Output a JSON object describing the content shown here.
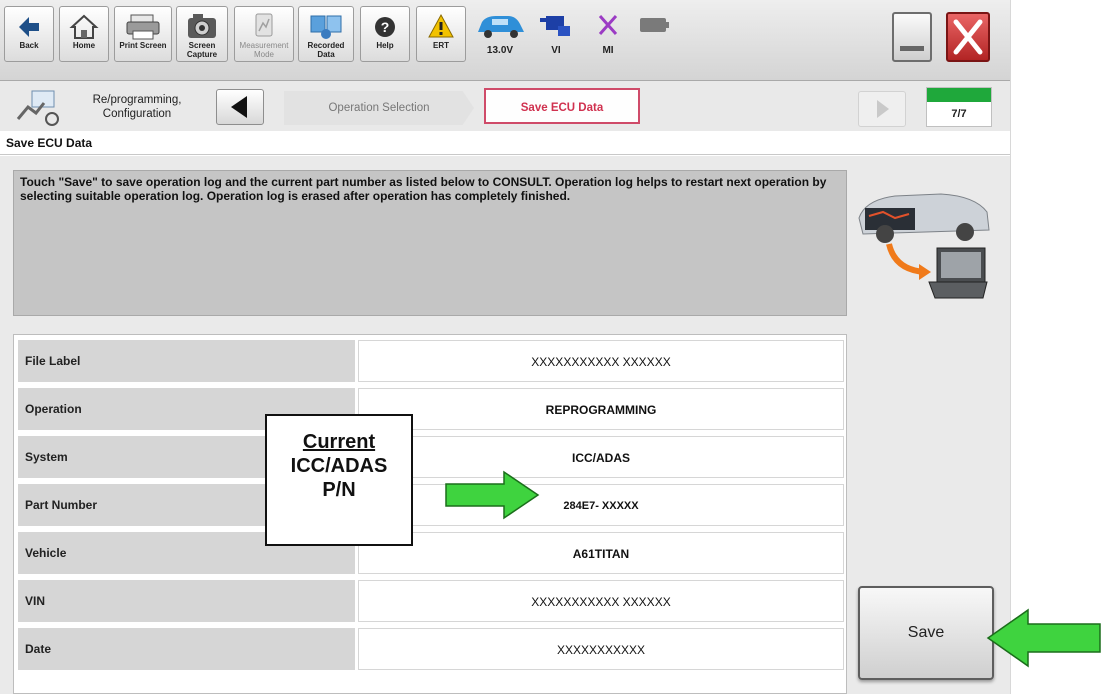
{
  "toolbar": {
    "buttons": [
      {
        "id": "back",
        "label": "Back",
        "icon": "back-arrow-icon"
      },
      {
        "id": "home",
        "label": "Home",
        "icon": "home-icon"
      },
      {
        "id": "print",
        "label": "Print Screen",
        "icon": "printer-icon"
      },
      {
        "id": "capture",
        "label": "Screen Capture",
        "icon": "camera-icon"
      },
      {
        "id": "measure",
        "label": "Measurement Mode",
        "icon": "measurement-icon"
      },
      {
        "id": "recorded",
        "label": "Recorded Data",
        "icon": "recorded-data-icon"
      },
      {
        "id": "help",
        "label": "Help",
        "icon": "help-icon"
      },
      {
        "id": "ert",
        "label": "ERT",
        "icon": "warning-icon"
      }
    ],
    "voltage": "13.0V",
    "vi_label": "VI",
    "mi_label": "MI"
  },
  "nav": {
    "section_label": "Re/programming, Configuration",
    "crumbs": [
      {
        "label": "Operation Selection",
        "active": false
      },
      {
        "label": "Save ECU Data",
        "active": true
      }
    ],
    "progress_text": "7/7",
    "progress_fraction": 1.0
  },
  "page": {
    "title": "Save ECU Data",
    "message": "Touch \"Save\" to save operation log and the current part number as listed below to CONSULT. Operation log helps to restart next operation by selecting suitable operation log. Operation log is erased after operation has completely finished."
  },
  "table": {
    "rows": [
      {
        "label": "File Label",
        "value": "XXXXXXXXXXX XXXXXX",
        "bold": false
      },
      {
        "label": "Operation",
        "value": "REPROGRAMMING",
        "bold": true
      },
      {
        "label": "System",
        "value": "ICC/ADAS",
        "bold": true
      },
      {
        "label": "Part Number",
        "value": "284E7- XXXXX",
        "bold": true
      },
      {
        "label": "Vehicle",
        "value": "A61TITAN",
        "bold": true
      },
      {
        "label": "VIN",
        "value": "XXXXXXXXXXX XXXXXX",
        "bold": false
      },
      {
        "label": "Date",
        "value": "XXXXXXXXXXX",
        "bold": false
      }
    ]
  },
  "save_button": {
    "label": "Save"
  },
  "callout": {
    "line1": "Current",
    "line2": "ICC/ADAS",
    "line3": "P/N"
  },
  "colors": {
    "accent_green": "#3fd33f",
    "crumb_active": "#d0314f",
    "close_red": "#c43030"
  }
}
